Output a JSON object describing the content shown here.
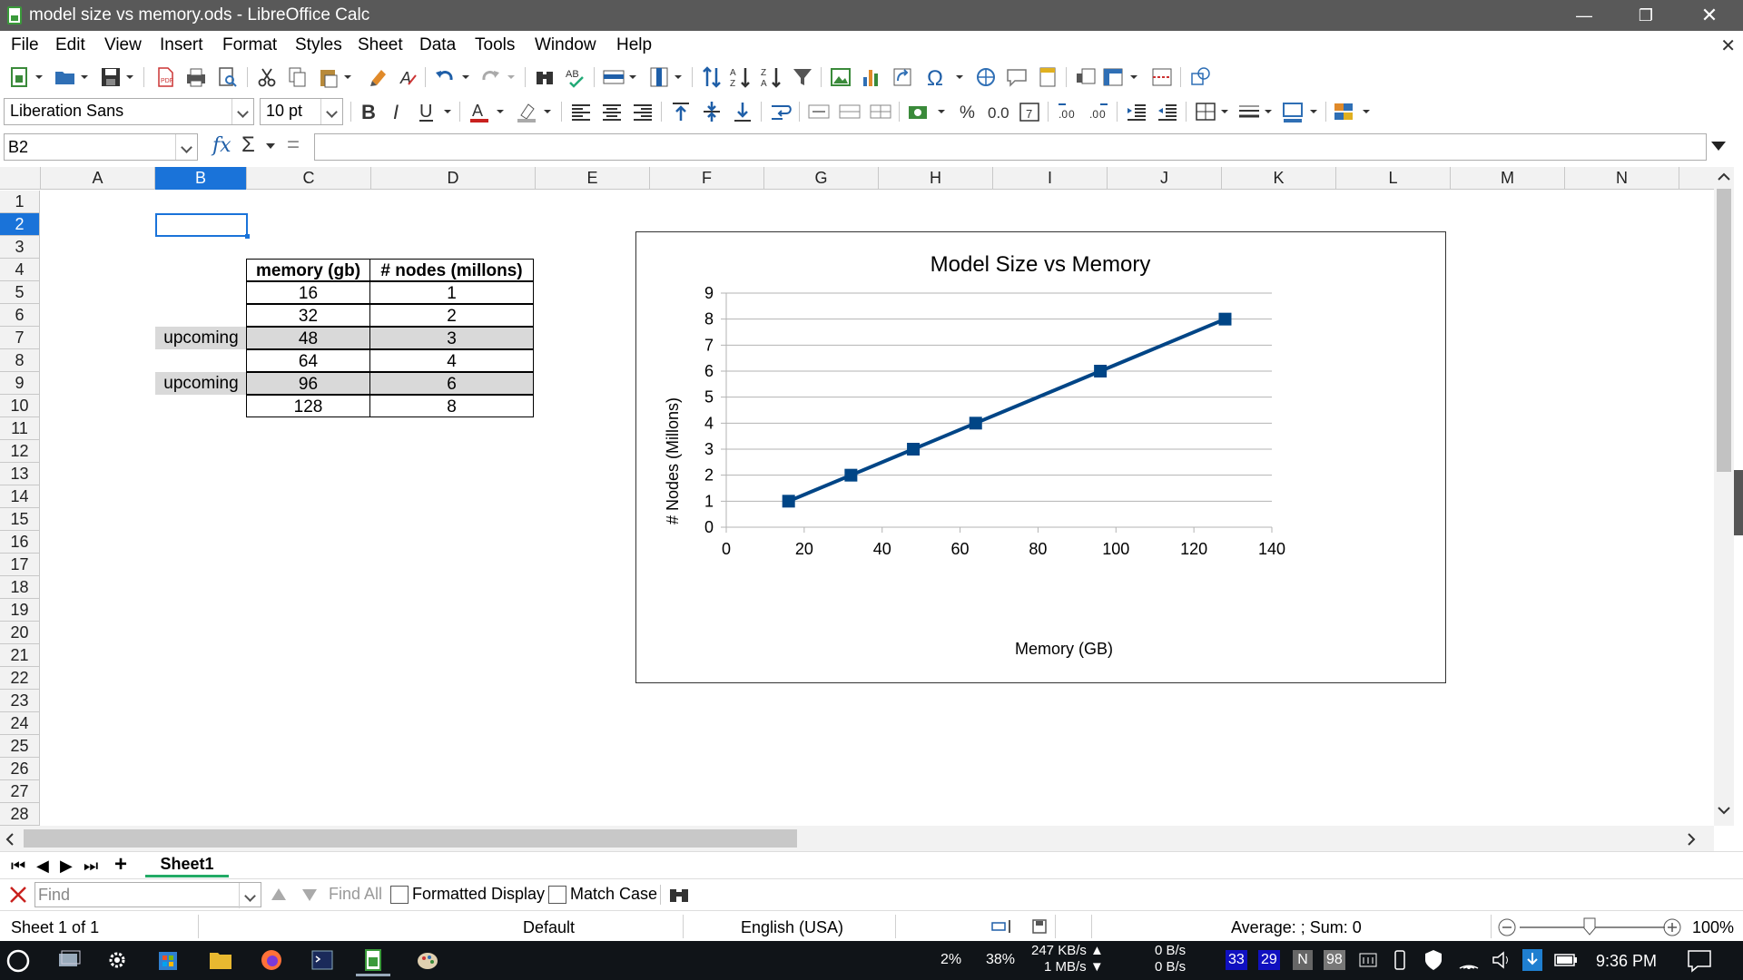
{
  "window": {
    "title": "model size vs memory.ods - LibreOffice Calc",
    "minimize": "—",
    "restore": "❐",
    "close": "✕"
  },
  "menu": [
    "File",
    "Edit",
    "View",
    "Insert",
    "Format",
    "Styles",
    "Sheet",
    "Data",
    "Tools",
    "Window",
    "Help"
  ],
  "formatting": {
    "font_name": "Liberation Sans",
    "font_size": "10 pt"
  },
  "formula_bar": {
    "cell_ref": "B2",
    "fx": "fx",
    "sum": "Σ",
    "equals": "=",
    "content": ""
  },
  "columns": [
    "A",
    "B",
    "C",
    "D",
    "E",
    "F",
    "G",
    "H",
    "I",
    "J",
    "K",
    "L",
    "M",
    "N"
  ],
  "rows": [
    "1",
    "2",
    "3",
    "4",
    "5",
    "6",
    "7",
    "8",
    "9",
    "10",
    "11",
    "12",
    "13",
    "14",
    "15",
    "16",
    "17",
    "18",
    "19",
    "20",
    "21",
    "22",
    "23",
    "24",
    "25",
    "26",
    "27",
    "28"
  ],
  "selected_cell": {
    "column": "B",
    "row": "2"
  },
  "table": {
    "headers": [
      "memory (gb)",
      "# nodes (millons)"
    ],
    "rows": [
      {
        "label": "",
        "memory": "16",
        "nodes": "1"
      },
      {
        "label": "",
        "memory": "32",
        "nodes": "2"
      },
      {
        "label": "upcoming",
        "memory": "48",
        "nodes": "3"
      },
      {
        "label": "",
        "memory": "64",
        "nodes": "4"
      },
      {
        "label": "upcoming",
        "memory": "96",
        "nodes": "6"
      },
      {
        "label": "",
        "memory": "128",
        "nodes": "8"
      }
    ]
  },
  "chart_data": {
    "type": "line",
    "title": "Model Size vs Memory",
    "xlabel": "Memory (GB)",
    "ylabel": "# Nodes (Millons)",
    "x": [
      16,
      32,
      48,
      64,
      96,
      128
    ],
    "series": [
      {
        "values": [
          1,
          2,
          3,
          4,
          6,
          8
        ],
        "color": "#004586",
        "marker": "square"
      }
    ],
    "xlim": [
      0,
      140
    ],
    "ylim": [
      0,
      9
    ],
    "xticks": [
      0,
      20,
      40,
      60,
      80,
      100,
      120,
      140
    ],
    "yticks": [
      0,
      1,
      2,
      3,
      4,
      5,
      6,
      7,
      8,
      9
    ],
    "grid": "horizontal",
    "legend": "none"
  },
  "sheet_tabs": {
    "active": "Sheet1"
  },
  "find_bar": {
    "placeholder": "Find",
    "find_all": "Find All",
    "formatted_display": "Formatted Display",
    "match_case": "Match Case"
  },
  "status": {
    "sheet": "Sheet 1 of 1",
    "page_style": "Default",
    "language": "English (USA)",
    "summary": "Average: ; Sum: 0",
    "zoom": "100%"
  },
  "taskbar": {
    "cpu": "2%",
    "mem": "38%",
    "net_up": "247 KB/s ▲",
    "net_down": "1 MB/s ▼",
    "disk_read": "0 B/s",
    "disk_write": "0 B/s",
    "badge1": "33",
    "badge2": "29",
    "badge3": "N",
    "badge4": "98",
    "time": "9:36 PM"
  }
}
